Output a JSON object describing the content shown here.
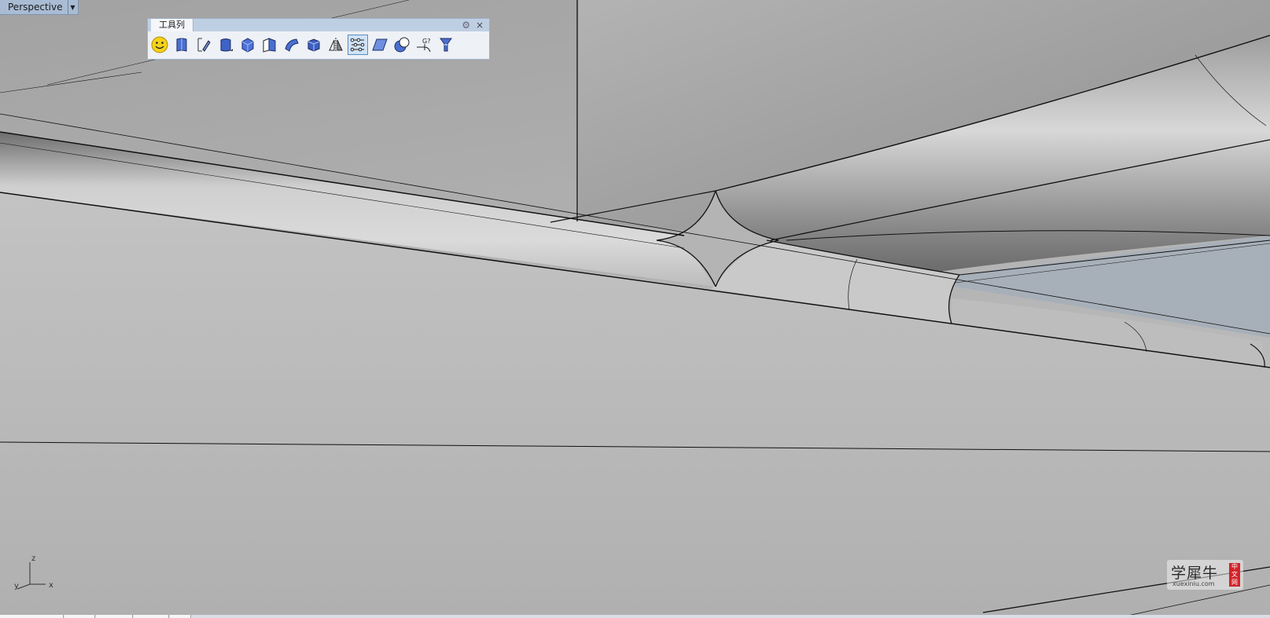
{
  "viewport": {
    "name": "Perspective",
    "axes": {
      "z": "z",
      "y": "y",
      "x": "x"
    }
  },
  "toolbar": {
    "title": "工具列",
    "gear_glyph": "⚙",
    "close_glyph": "×",
    "icons": [
      "smiley-icon",
      "surface-icon",
      "curve-edit-icon",
      "solid-icon",
      "box-icon",
      "extrude-icon",
      "sweep-icon",
      "cube-icon",
      "mirror-icon",
      "point-edit-icon",
      "plane-icon",
      "boolean-icon",
      "analyze-icon",
      "render-icon"
    ],
    "active_icon": "point-edit-icon"
  },
  "watermark": {
    "main": "学犀牛",
    "sub": "xuexiniu.com",
    "badge": "中文网"
  },
  "colors": {
    "viewport_tab": "#a9bcd4",
    "toolbar_bg": "#eef1f5",
    "watermark_badge": "#d2232a"
  }
}
